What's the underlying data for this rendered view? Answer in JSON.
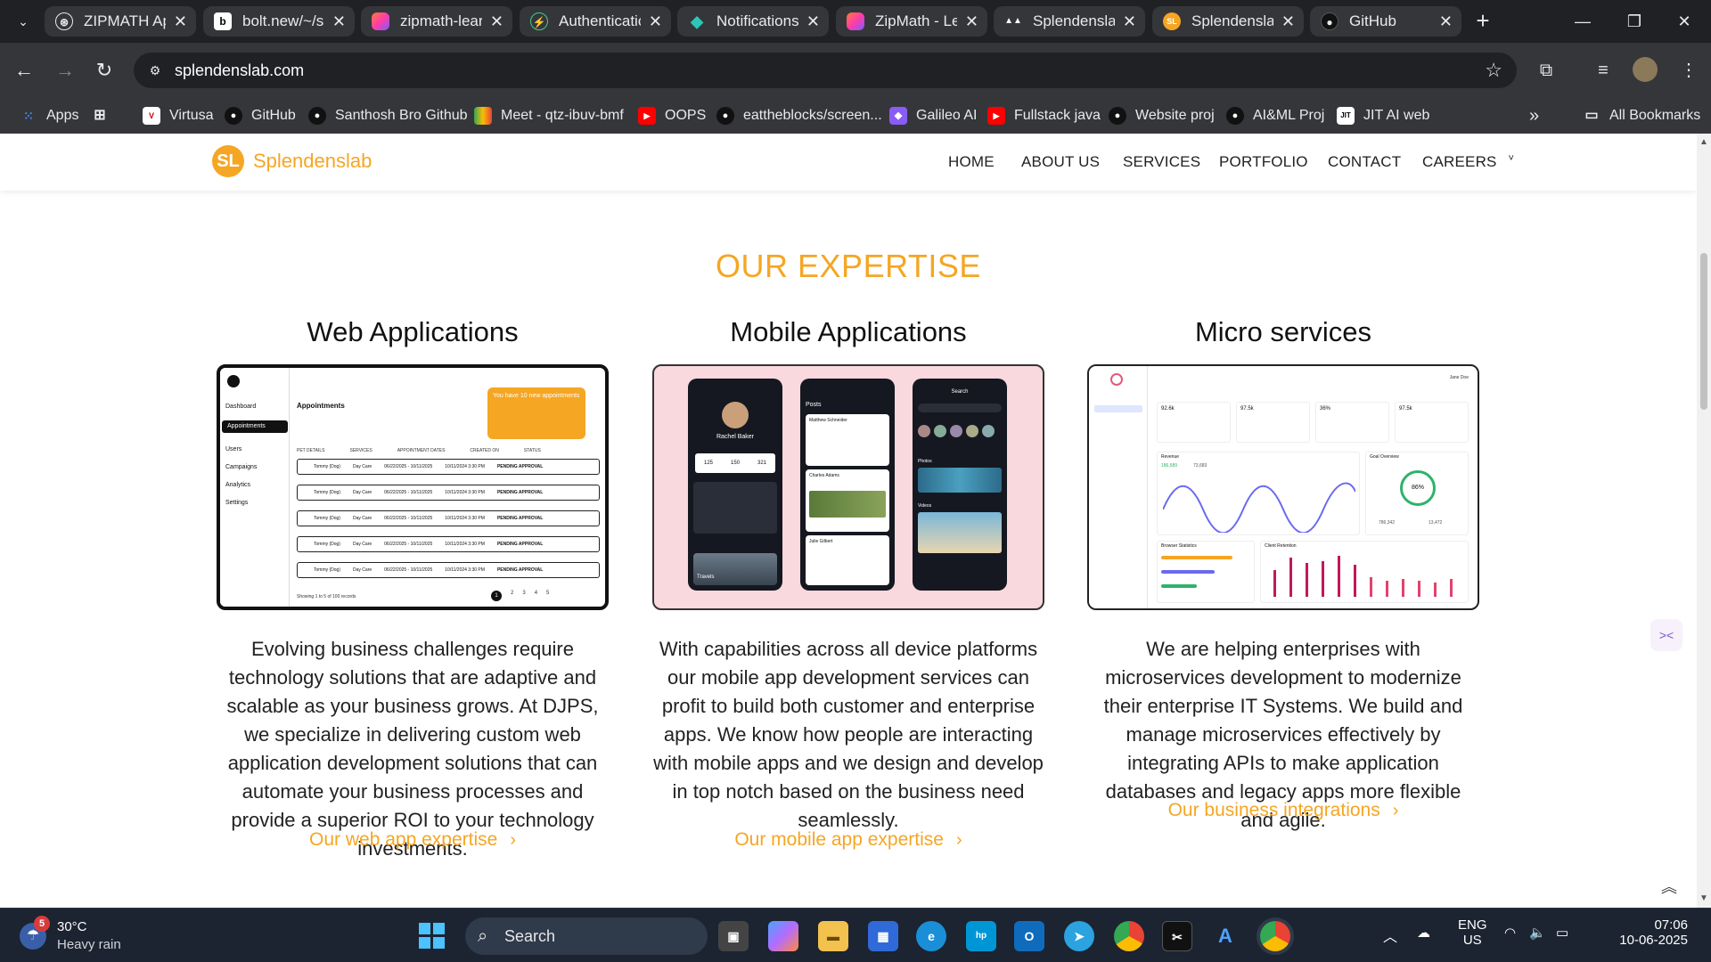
{
  "browser": {
    "tabs": [
      {
        "label": "ZIPMATH App",
        "icon": "gpt-icon",
        "color": "#e8eaed"
      },
      {
        "label": "bolt.new/~/sb",
        "icon": "bolt-icon",
        "color": "#e8eaed"
      },
      {
        "label": "zipmath-learn",
        "icon": "lovable-icon",
        "color": "#ff5fa0"
      },
      {
        "label": "Authentication",
        "icon": "supabase-icon",
        "color": "#3ecf8e"
      },
      {
        "label": "Notifications",
        "icon": "diamond-icon",
        "color": "#2ec4b6"
      },
      {
        "label": "ZipMath - Lea",
        "icon": "lovable-icon",
        "color": "#ff5fa0"
      },
      {
        "label": "Splendenslab",
        "icon": "vercel-icon",
        "color": "#ffffff"
      },
      {
        "label": "Splendenslab",
        "icon": "sl-logo-icon",
        "color": "#f5a623"
      },
      {
        "label": "GitHub",
        "icon": "github-icon",
        "color": "#e8eaed"
      }
    ],
    "url": "splendenslab.com",
    "bookmarks": [
      {
        "label": "Apps",
        "icon": "apps-grid-icon"
      },
      {
        "label": "",
        "icon": "grid-icon"
      },
      {
        "label": "Virtusa",
        "icon": "virtusa-icon"
      },
      {
        "label": "GitHub",
        "icon": "github-icon"
      },
      {
        "label": "Santhosh Bro Github",
        "icon": "github-icon"
      },
      {
        "label": "Meet - qtz-ibuv-bmf",
        "icon": "meet-icon"
      },
      {
        "label": "OOPS",
        "icon": "youtube-icon"
      },
      {
        "label": "eattheblocks/screen...",
        "icon": "github-icon"
      },
      {
        "label": "Galileo AI",
        "icon": "galileo-icon"
      },
      {
        "label": "Fullstack java",
        "icon": "youtube-icon"
      },
      {
        "label": "Website proj",
        "icon": "github-icon"
      },
      {
        "label": "AI&ML Proj",
        "icon": "github-icon"
      },
      {
        "label": "JIT AI web",
        "icon": "jit-icon"
      }
    ],
    "all_bookmarks": "All Bookmarks"
  },
  "site": {
    "logo_mark": "SL",
    "brand": "Splendenslab",
    "nav": [
      "HOME",
      "ABOUT US",
      "SERVICES",
      "PORTFOLIO",
      "CONTACT",
      "CAREERS"
    ],
    "section_title": "OUR EXPERTISE",
    "columns": [
      {
        "title": "Web Applications",
        "description": "Evolving business challenges require technology solutions that are adaptive and scalable as your business grows. At DJPS, we specialize in delivering custom web application development solutions that can automate your business processes and provide a superior ROI to your technology investments.",
        "link": "Our web app expertise"
      },
      {
        "title": "Mobile Applications",
        "description": "With capabilities across all device platforms our mobile app development services can profit to build both customer and enterprise apps. We know how people are interacting with mobile apps and we design and develop in top notch based on the business need seamlessly.",
        "link": "Our mobile app expertise"
      },
      {
        "title": "Micro services",
        "description": "We are helping enterprises with microservices development to modernize their enterprise IT Systems. We build and manage microservices effectively by integrating APIs to make application databases and legacy apps more flexible and agile.",
        "link": "Our business integrations"
      }
    ],
    "web_mockup": {
      "sidebar": [
        "Dashboard",
        "Appointments",
        "Users",
        "Campaigns",
        "Analytics",
        "Settings"
      ],
      "heading": "Appointments",
      "columns": [
        "PET DETAILS",
        "SERVICES",
        "APPOINTMENT DATES",
        "CREATED ON",
        "STATUS"
      ],
      "rows": [
        {
          "pet": "Tommy (Dog)",
          "service": "Day Care",
          "dates": "06/22/2025 - 10/11/2025",
          "created": "10/11/2024 3:30 PM",
          "status": "PENDING APPROVAL"
        },
        {
          "pet": "Tommy (Dog)",
          "service": "Day Care",
          "dates": "06/22/2025 - 10/11/2025",
          "created": "10/11/2024 3:30 PM",
          "status": "PENDING APPROVAL"
        },
        {
          "pet": "Tommy (Dog)",
          "service": "Day Care",
          "dates": "06/22/2025 - 10/11/2025",
          "created": "10/11/2024 3:30 PM",
          "status": "PENDING APPROVAL"
        },
        {
          "pet": "Tommy (Dog)",
          "service": "Day Care",
          "dates": "06/22/2025 - 10/11/2025",
          "created": "10/11/2024 3:30 PM",
          "status": "PENDING APPROVAL"
        },
        {
          "pet": "Tommy (Dog)",
          "service": "Day Care",
          "dates": "06/22/2025 - 10/11/2025",
          "created": "10/11/2024 3:30 PM",
          "status": "PENDING APPROVAL"
        }
      ],
      "banner": "You have 10 new appointments",
      "footer": "Showing 1 to 5 of 100 records",
      "pages": [
        "1",
        "2",
        "3",
        "4",
        "5"
      ]
    },
    "mobile_mockup": {
      "profile_name": "Rachel Baker",
      "stats": [
        "125",
        "150",
        "321"
      ],
      "posts_title": "Posts",
      "post_authors": [
        "Matthew Schneider",
        "Charles Adams",
        "Julie Gilbert"
      ],
      "search_title": "Search",
      "photos_label": "Photos",
      "videos_label": "Videos",
      "travel_label": "Travels"
    },
    "micro_mockup": {
      "kpis": [
        "92.6k",
        "97.5k",
        "36%",
        "97.5k"
      ],
      "revenue_label": "Revenue",
      "revenue_values": [
        "186,589",
        "73,683"
      ],
      "goal_label": "Goal Overview",
      "goal_value": "86%",
      "goal_stats": [
        "786,342",
        "13,472"
      ],
      "browser_label": "Browser Statistics",
      "retention_label": "Client Retention",
      "user": "Jane Doe"
    }
  },
  "taskbar": {
    "weather_badge": "5",
    "temperature": "30°C",
    "condition": "Heavy rain",
    "search_placeholder": "Search",
    "lang_1": "ENG",
    "lang_2": "US",
    "time": "07:06",
    "date": "10-06-2025"
  },
  "colors": {
    "accent": "#f5a623",
    "chrome_dark": "#202124",
    "chrome_toolbar": "#35363a",
    "taskbar": "#1c2431"
  }
}
